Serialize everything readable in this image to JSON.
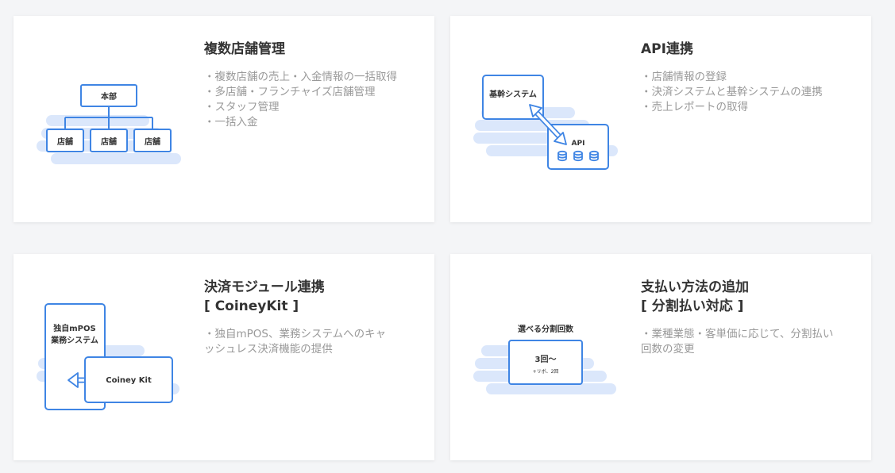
{
  "colors": {
    "accent": "#3f85e4",
    "cloud": "#dbe7fb",
    "title": "#333333",
    "body_text": "#999999",
    "background": "#f4f5f7"
  },
  "cards": [
    {
      "title_lines": [
        "複数店舗管理"
      ],
      "items": [
        "・複数店舗の売上・入金情報の一括取得",
        "・多店舗・フランチャイズ店舗管理",
        "・スタッフ管理",
        "・一括入金"
      ],
      "illustration": {
        "head_label": "本部",
        "branch_labels": [
          "店舗",
          "店舗",
          "店舗"
        ]
      }
    },
    {
      "title_lines": [
        "API連携"
      ],
      "items": [
        "・店舗情報の登録",
        "・決済システムと基幹システムの連携",
        "・売上レポートの取得"
      ],
      "illustration": {
        "system_label": "基幹システム",
        "api_label": "API",
        "icon": "database-icon"
      }
    },
    {
      "title_lines": [
        "決済モジュール連携",
        "[ CoineyKit ]"
      ],
      "desc_lines": [
        "・独自mPOS、業務システムへのキャ",
        "ッシュレス決済機能の提供"
      ],
      "illustration": {
        "host_label_lines": [
          "独自mPOS",
          "業務システム"
        ],
        "kit_label": "Coiney Kit",
        "icon": "arrow-left-icon"
      }
    },
    {
      "title_lines": [
        "支払い方法の追加",
        "[ 分割払い対応 ]"
      ],
      "desc_lines": [
        "・業種業態・客単価に応じて、分割払い",
        "回数の変更"
      ],
      "illustration": {
        "caption": "選べる分割回数",
        "main": "3回〜",
        "sub": "+リボ、2回"
      }
    }
  ]
}
